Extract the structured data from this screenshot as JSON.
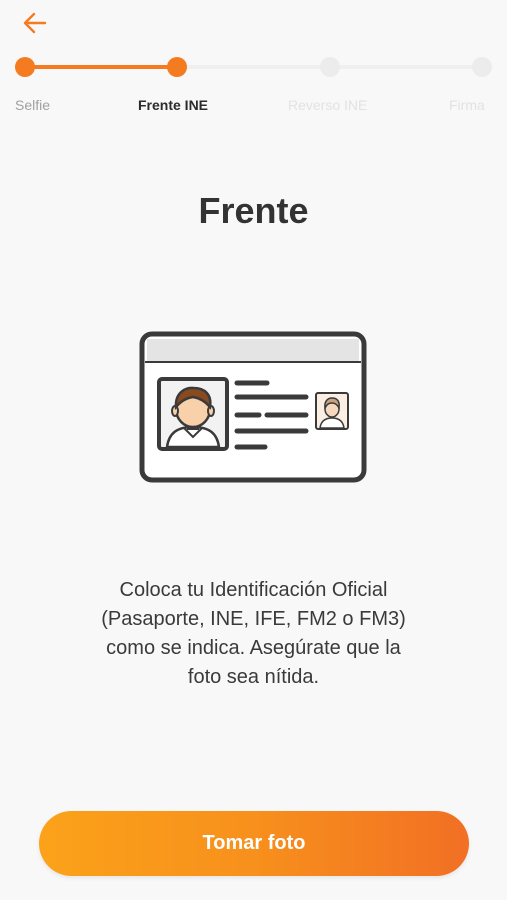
{
  "header": {
    "back_icon": "arrow-left-icon",
    "accent_color": "#f47b20"
  },
  "stepper": {
    "steps": [
      {
        "label": "Selfie",
        "state": "done"
      },
      {
        "label": "Frente INE",
        "state": "current"
      },
      {
        "label": "Reverso INE",
        "state": "todo"
      },
      {
        "label": "Firma",
        "state": "todo"
      }
    ]
  },
  "main": {
    "title": "Frente",
    "illustration_icon": "id-card-icon",
    "instructions": "Coloca tu Identificación Oficial (Pasaporte, INE, IFE, FM2 o FM3) como se indica. Asegúrate que la foto sea nítida."
  },
  "action": {
    "button_label": "Tomar foto",
    "gradient_start": "#fba21a",
    "gradient_end": "#f26f24"
  }
}
